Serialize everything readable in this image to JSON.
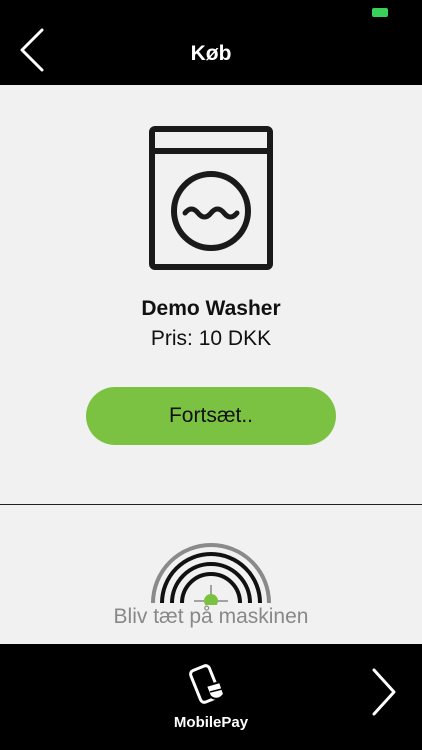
{
  "colors": {
    "accent_green": "#7cc242",
    "panel_background": "#f1f1f1",
    "bar_background": "#000000",
    "hint_text": "#888888",
    "battery": "#3ad15a"
  },
  "status_bar": {
    "battery_icon": "battery-icon"
  },
  "nav": {
    "title": "Køb",
    "back_icon": "chevron-left-icon"
  },
  "machine": {
    "icon": "washing-machine-icon",
    "name": "Demo Washer",
    "price": "Pris: 10 DKK"
  },
  "actions": {
    "continue_label": "Fortsæt.."
  },
  "proximity": {
    "icon": "signal-arc-icon",
    "text": "Bliv tæt på maskinen"
  },
  "bottom_bar": {
    "brand_icon": "mobilepay-icon",
    "brand_label": "MobilePay",
    "forward_icon": "chevron-right-icon"
  }
}
